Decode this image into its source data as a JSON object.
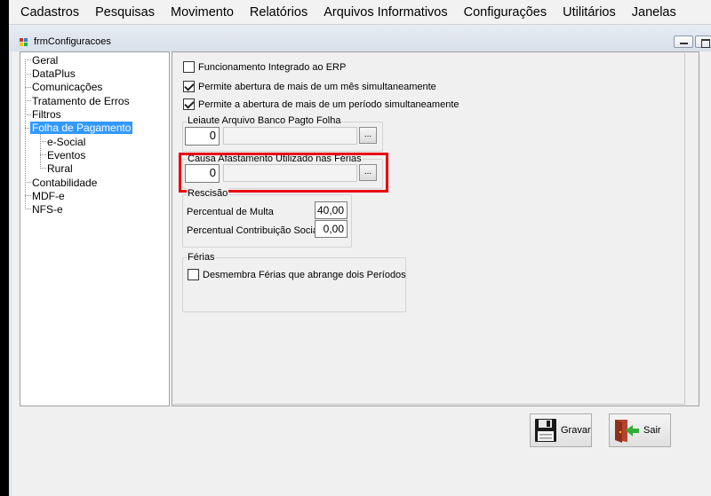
{
  "menu": {
    "items": [
      "Cadastros",
      "Pesquisas",
      "Movimento",
      "Relatórios",
      "Arquivos Informativos",
      "Configurações",
      "Utilitários",
      "Janelas"
    ]
  },
  "window": {
    "title": "frmConfiguracoes"
  },
  "tree": {
    "items": [
      "Geral",
      "DataPlus",
      "Comunicações",
      "Tratamento de Erros",
      "Filtros",
      "Folha de Pagamento",
      "e-Social",
      "Eventos",
      "Rural",
      "Contabilidade",
      "MDF-e",
      "NFS-e"
    ],
    "selected": "Folha de Pagamento"
  },
  "settings": {
    "checkboxes": [
      {
        "label": "Funcionamento Integrado ao ERP",
        "checked": false
      },
      {
        "label": "Permite abertura de mais de um mês simultaneamente",
        "checked": true
      },
      {
        "label": "Permite a abertura de mais de um período simultaneamente",
        "checked": true
      }
    ],
    "leiaute": {
      "legend": "Leiaute Arquivo Banco Pagto Folha",
      "code": "0",
      "button": "..."
    },
    "causa": {
      "legend": "Causa Afastamento Utilizado nas Férias",
      "code": "0",
      "button": "..."
    },
    "rescisao": {
      "legend": "Rescisão",
      "multa_label": "Percentual de Multa",
      "multa_value": "40,00",
      "contrib_label": "Percentual Contribuição Social",
      "contrib_value": "0,00"
    },
    "ferias": {
      "legend": "Férias",
      "checkbox_label": "Desmembra Férias que abrange dois Períodos",
      "checked": false
    }
  },
  "buttons": {
    "save_label": "Gravar",
    "exit_label": "Sair"
  },
  "colors": {
    "selection": "#3399ff",
    "highlight": "#e8000f"
  }
}
